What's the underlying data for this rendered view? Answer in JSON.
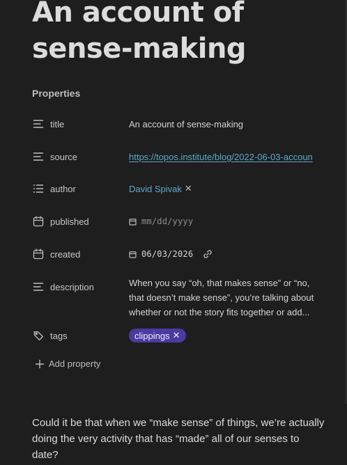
{
  "note": {
    "title": "An account of sense-making",
    "body": "Could it be that when we “make sense” of things, we’re actually doing the very activity that has “made” all of our senses to date?"
  },
  "properties": {
    "heading": "Properties",
    "title": {
      "key": "title",
      "value": "An account of sense-making",
      "icon": "text-lines-icon"
    },
    "source": {
      "key": "source",
      "value": "https://topos.institute/blog/2022-06-03-accoun",
      "icon": "text-lines-icon"
    },
    "author": {
      "key": "author",
      "value": "David Spivak",
      "remove": "✕",
      "icon": "list-icon"
    },
    "published": {
      "key": "published",
      "value": "mm/dd/yyyy",
      "icon": "calendar-icon"
    },
    "created": {
      "key": "created",
      "value": "06/03/2026",
      "icon": "calendar-icon"
    },
    "description": {
      "key": "description",
      "value": "When you say “oh, that makes sense” or “no, that doesn’t make sense”, you’re talking about whether or not the story fits together or add...",
      "icon": "text-lines-icon"
    },
    "tags": {
      "key": "tags",
      "value": "clippings",
      "remove": "✕",
      "icon": "tags-icon"
    },
    "add_label": "Add property"
  },
  "colors": {
    "background": "#1e1e1e",
    "link": "#5fa8c9",
    "tag_pill": "#4b3aa0"
  }
}
